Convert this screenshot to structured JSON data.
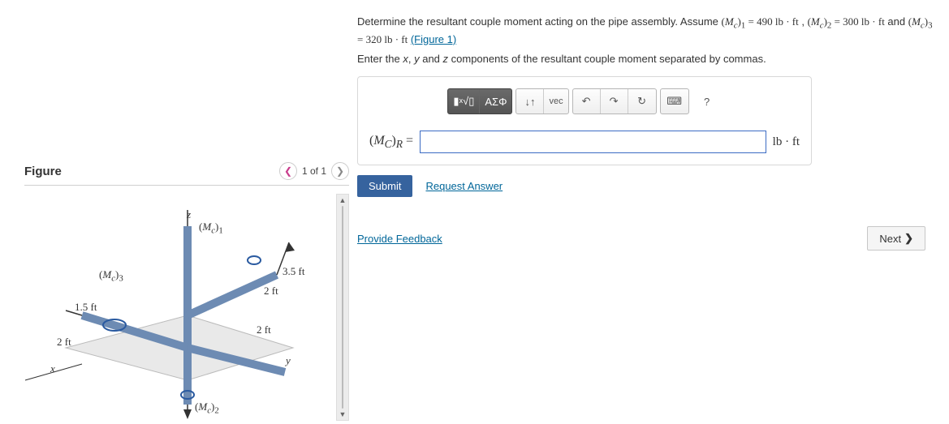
{
  "figure": {
    "title": "Figure",
    "pager_text": "1 of 1",
    "labels": {
      "mc1": "(M_c)₁",
      "mc2": "(M_c)₂",
      "mc3": "(M_c)₃",
      "d35": "3.5 ft",
      "d2a": "2 ft",
      "d2b": "2 ft",
      "d2c": "2 ft",
      "d15": "1.5 ft",
      "x": "x",
      "y": "y",
      "z": "z"
    }
  },
  "problem": {
    "line1_pre": "Determine the resultant couple moment acting on the pipe assembly. Assume ",
    "mc1_eq": "(M_c)₁ = 490 lb · ft",
    "sep1": " , ",
    "mc2_eq": "(M_c)₂ = 300 lb · ft",
    "and_text": " and ",
    "mc3_eq": "(M_c)₃ = 320 lb · ft",
    "fig_link": "(Figure 1)",
    "line2": "Enter the x, y and z components of the resultant couple moment separated by commas."
  },
  "toolbar": {
    "templates_icon": "▮√▯",
    "greek": "ΑΣΦ",
    "sort": "↓↑",
    "vec": "vec",
    "undo": "↶",
    "redo": "↷",
    "reset": "↻",
    "keyboard": "⌨",
    "help": "?"
  },
  "answer": {
    "lhs": "(M_C)_R =",
    "value": "",
    "unit": "lb · ft"
  },
  "actions": {
    "submit": "Submit",
    "request": "Request Answer",
    "feedback": "Provide Feedback",
    "next": "Next"
  }
}
